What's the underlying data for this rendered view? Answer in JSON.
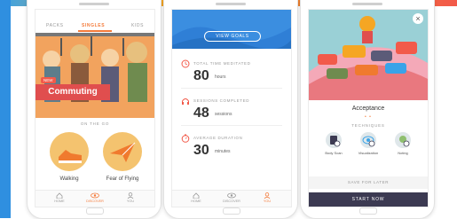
{
  "colors": {
    "accent": "#f47b3b",
    "blue": "#2f7fd6",
    "dark": "#3c3a52",
    "red": "#e04e4e"
  },
  "screen1": {
    "tabs": [
      "PACKS",
      "SINGLES",
      "KIDS"
    ],
    "active_tab": "SINGLES",
    "new_badge": "NEW",
    "hero_title": "Commuting",
    "section_label": "ON THE GO",
    "items": [
      {
        "label": "Walking",
        "icon": "shoe-icon"
      },
      {
        "label": "Fear of Flying",
        "icon": "paper-plane-icon"
      }
    ],
    "nav": [
      {
        "label": "HOME",
        "icon": "home-icon"
      },
      {
        "label": "DISCOVER",
        "icon": "eye-icon"
      },
      {
        "label": "YOU",
        "icon": "person-icon"
      }
    ]
  },
  "screen2": {
    "view_goals": "VIEW GOALS",
    "stats": [
      {
        "label": "TOTAL TIME MEDITATED",
        "value": "80",
        "unit": "hours",
        "icon": "clock-icon"
      },
      {
        "label": "SESSIONS COMPLETED",
        "value": "48",
        "unit": "sessions",
        "icon": "headphones-icon"
      },
      {
        "label": "AVERAGE DURATION",
        "value": "30",
        "unit": "minutes",
        "icon": "stopwatch-icon"
      }
    ],
    "nav": [
      {
        "label": "HOME",
        "icon": "home-icon"
      },
      {
        "label": "DISCOVER",
        "icon": "eye-icon"
      },
      {
        "label": "YOU",
        "icon": "person-icon"
      }
    ]
  },
  "screen3": {
    "title": "Acceptance",
    "dots": "• •",
    "techniques_label": "TECHNIQUES",
    "techniques": [
      {
        "label": "Body Scan",
        "icon": "body-scan-icon"
      },
      {
        "label": "Visualization",
        "icon": "visualization-icon"
      },
      {
        "label": "Noting",
        "icon": "noting-icon"
      }
    ],
    "save_later": "SAVE FOR LATER",
    "start_now": "START NOW"
  }
}
